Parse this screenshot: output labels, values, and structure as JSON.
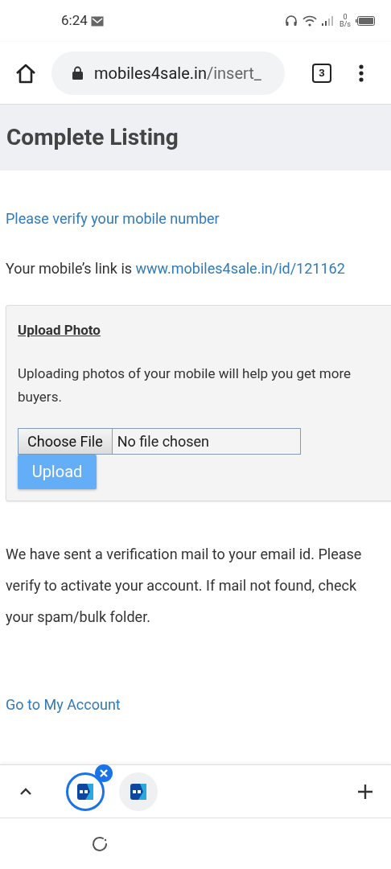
{
  "status_bar": {
    "time": "6:24",
    "net_speed_value": "0",
    "net_speed_unit": "B/s"
  },
  "toolbar": {
    "url_host": "mobiles4sale.in",
    "url_path": "/insert_",
    "tab_count": "3"
  },
  "page": {
    "title": "Complete Listing",
    "verify_link": "Please verify your mobile number",
    "link_line": {
      "text": "Your mobile’s link is ",
      "link": "www.mobiles4sale.in/id/121162"
    },
    "upload_panel": {
      "title": "Upload Photo",
      "text": "Uploading photos of your mobile will help you get more buyers.",
      "choose_button": "Choose File",
      "file_status": "No file chosen",
      "upload_button": "Upload"
    },
    "notice": "We have sent a verification mail to your email id. Please verify to activate your account. If mail not found, check your spam/bulk folder.",
    "account_link": "Go to My Account"
  },
  "tab_strip": {
    "tabs": [
      {
        "selected": true
      },
      {
        "selected": false
      }
    ]
  }
}
